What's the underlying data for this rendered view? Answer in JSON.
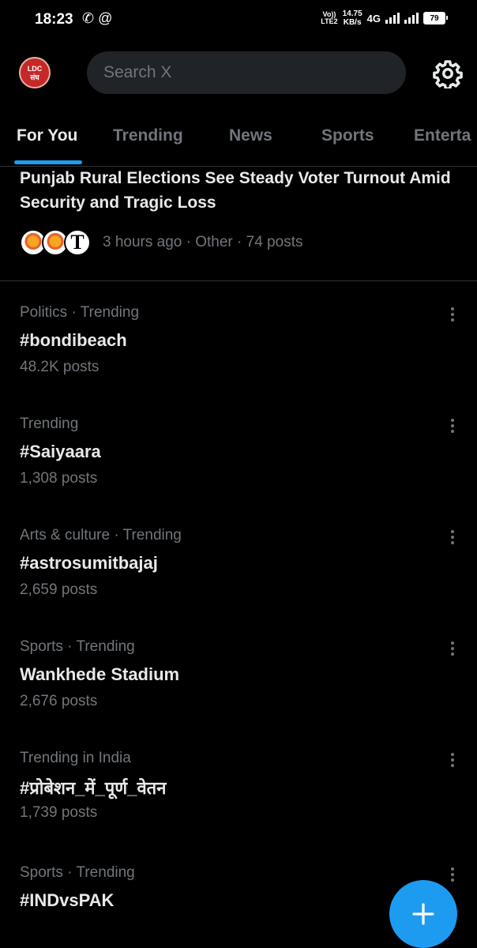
{
  "status_bar": {
    "time": "18:23",
    "left_icons": "✆ @",
    "volte_line1": "Vo))",
    "volte_line2": "LTE2",
    "speed_value": "14.75",
    "speed_unit": "KB/s",
    "network": "4G",
    "battery": "79"
  },
  "header": {
    "avatar_line1": "LDC",
    "avatar_line2": "संघ",
    "search_placeholder": "Search X",
    "settings_icon": "gear-icon"
  },
  "tabs": [
    {
      "label": "For You",
      "active": true
    },
    {
      "label": "Trending",
      "active": false
    },
    {
      "label": "News",
      "active": false
    },
    {
      "label": "Sports",
      "active": false
    },
    {
      "label": "Enterta",
      "active": false
    }
  ],
  "news": {
    "headline": "Punjab Rural Elections See Steady Voter Turnout Amid Security and Tragic Loss",
    "meta": "3 hours ago · Other · 74 posts"
  },
  "trends": [
    {
      "context": "Politics · Trending",
      "name": "#bondibeach",
      "count": "48.2K posts"
    },
    {
      "context": "Trending",
      "name": "#Saiyaara",
      "count": "1,308 posts"
    },
    {
      "context": "Arts & culture · Trending",
      "name": "#astrosumitbajaj",
      "count": "2,659 posts"
    },
    {
      "context": "Sports · Trending",
      "name": "Wankhede Stadium",
      "count": "2,676 posts"
    },
    {
      "context": "Trending in India",
      "name": "#प्रोबेशन_में_पूर्ण_वेतन",
      "count": "1,739 posts"
    },
    {
      "context": "Sports · Trending",
      "name": "#INDvsPAK",
      "count": ""
    }
  ],
  "colors": {
    "accent": "#1d9bf0",
    "background": "#000000",
    "muted_text": "#71767b"
  }
}
